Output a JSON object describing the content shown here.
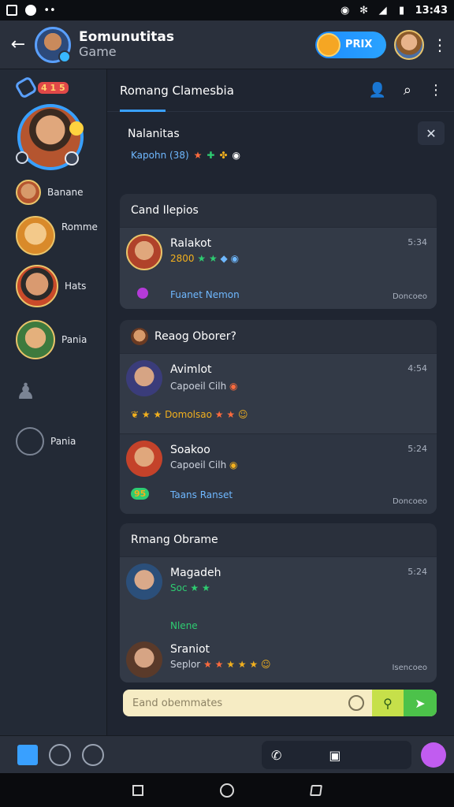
{
  "status": {
    "time": "13:43"
  },
  "appbar": {
    "title": "Eomunutitas",
    "subtitle": "Game",
    "pill": "PRIX"
  },
  "sidebar": {
    "badge": "4 1 5",
    "items": [
      {
        "label": "Banane"
      },
      {
        "label": "Romme"
      },
      {
        "label": "Hats"
      },
      {
        "label": "Pania"
      },
      {
        "label": "Pania"
      }
    ]
  },
  "tabs": {
    "active": "Romang Clamesbia"
  },
  "notice": {
    "title": "Nalanitas",
    "line": "Kapohn (38)"
  },
  "cards": [
    {
      "title": "Cand Ilepios",
      "rows": [
        {
          "name": "Ralakot",
          "sub": "2800",
          "time": "5:34",
          "footer": "Fuanet Nemon",
          "tag": "Doncoeo"
        }
      ]
    },
    {
      "title": "Reaog Oborer?",
      "rows": [
        {
          "name": "Avimlot",
          "sub": "Capoeil Cilh",
          "time": "4:54",
          "footer": "Domolsao"
        },
        {
          "name": "Soakoo",
          "sub": "Capoeil Cilh",
          "time": "5:24",
          "badge": "95",
          "footer": "Taans Ranset",
          "tag": "Doncoeo"
        }
      ]
    },
    {
      "title": "Rmang Obrame",
      "rows": [
        {
          "name": "Magadeh",
          "sub": "Soc",
          "time": "5:24",
          "footer": "Nlene"
        },
        {
          "name": "Sraniot",
          "sub": "Seplor",
          "tag": "Isencoeo"
        }
      ]
    }
  ],
  "compose": {
    "placeholder": "Eand obemmates"
  },
  "colors": {
    "accent": "#39a0ff",
    "card": "#2a303c",
    "bg": "#1f2531",
    "compose": "#f6ecc4"
  }
}
